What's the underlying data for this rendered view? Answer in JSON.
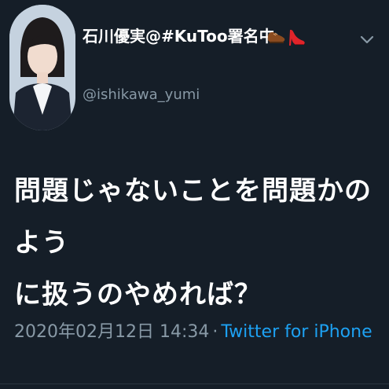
{
  "user": {
    "display_name": "石川優実@#KuToo署名中",
    "name_emojis": [
      "shoe-icon",
      "high-heel-icon"
    ],
    "handle": "@ishikawa_yumi"
  },
  "tweet": {
    "text": "問題じゃないことを問題かのよう\nに扱うのやめれば？",
    "timestamp": "2020年02月12日 14:34",
    "separator": "·",
    "source": "Twitter for iPhone"
  },
  "colors": {
    "background": "#151e28",
    "secondary_text": "#8899a6",
    "link": "#1da1f2"
  }
}
